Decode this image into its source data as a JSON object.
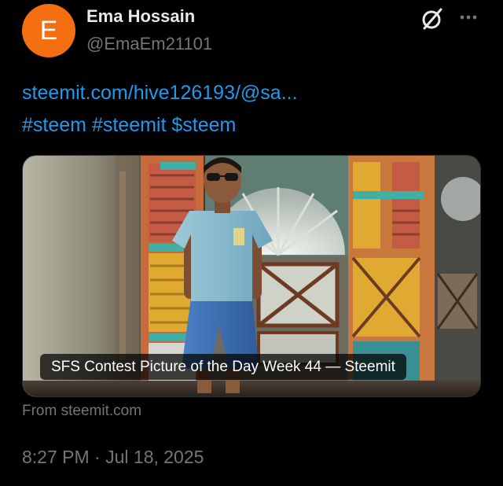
{
  "author": {
    "avatar_letter": "E",
    "avatar_color": "#f36f12",
    "display_name": "Ema Hossain",
    "handle": "@EmaEm21101"
  },
  "header_icons": [
    "grok-icon",
    "more-icon"
  ],
  "tweet": {
    "link_text": "steemit.com/hive126193/@sa...",
    "hashtags": [
      "#steem",
      "#steemit",
      "$steem"
    ]
  },
  "card": {
    "caption": "SFS Contest Picture of the Day Week 44 — Steemit",
    "source": "From steemit.com"
  },
  "meta": {
    "time": "8:27 PM",
    "separator": "·",
    "date": "Jul 18, 2025"
  },
  "colors": {
    "background": "#000000",
    "text_primary": "#e7e9ea",
    "text_secondary": "#71767b",
    "link": "#1d9bf0"
  }
}
